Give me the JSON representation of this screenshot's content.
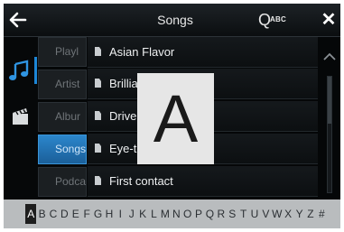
{
  "header": {
    "title": "Songs",
    "search_letter": "Q",
    "search_abc": "ABC",
    "close_glyph": "✕"
  },
  "categories": [
    {
      "label": "Playl",
      "active": false
    },
    {
      "label": "Artist",
      "active": false
    },
    {
      "label": "Albur",
      "active": false
    },
    {
      "label": "Songs",
      "active": true
    },
    {
      "label": "Podca",
      "active": false
    }
  ],
  "songs": [
    {
      "label": "Asian Flavor"
    },
    {
      "label": "Brillia"
    },
    {
      "label": "Drive"
    },
    {
      "label": "Eye-tc"
    },
    {
      "label": "First contact"
    }
  ],
  "letter_popup": "A",
  "alphabet": {
    "selected": "A",
    "letters": [
      "A",
      "B",
      "C",
      "D",
      "E",
      "F",
      "G",
      "H",
      "I",
      "J",
      "K",
      "L",
      "M",
      "N",
      "O",
      "P",
      "Q",
      "R",
      "S",
      "T",
      "U",
      "V",
      "W",
      "X",
      "Y",
      "Z",
      "#"
    ]
  },
  "colors": {
    "accent": "#1c86d6",
    "active_tab": "#2b86cc",
    "popup_bg": "#e6e6e6",
    "alphabet_bar": "#b9bcbe"
  }
}
